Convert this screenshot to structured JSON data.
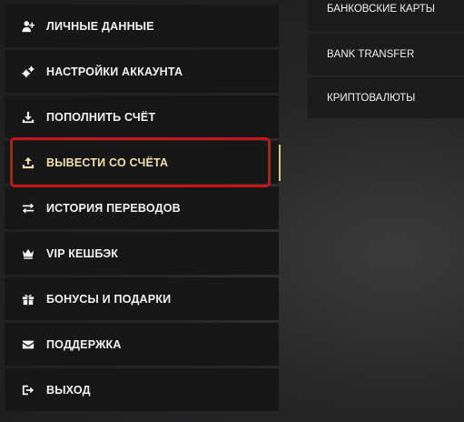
{
  "sidebar": {
    "items": [
      {
        "label": "ЛИЧНЫЕ ДАННЫЕ",
        "icon": "user-plus-icon"
      },
      {
        "label": "НАСТРОЙКИ АККАУНТА",
        "icon": "gears-icon"
      },
      {
        "label": "ПОПОЛНИТЬ СЧЁТ",
        "icon": "download-icon"
      },
      {
        "label": "ВЫВЕСТИ СО СЧЁТА",
        "icon": "upload-icon",
        "active": true
      },
      {
        "label": "ИСТОРИЯ ПЕРЕВОДОВ",
        "icon": "transfer-arrows-icon"
      },
      {
        "label": "VIP КЕШБЭК",
        "icon": "crown-icon"
      },
      {
        "label": "БОНУСЫ И ПОДАРКИ",
        "icon": "gift-icon"
      },
      {
        "label": "ПОДДЕРЖКА",
        "icon": "envelope-icon"
      },
      {
        "label": "ВЫХОД",
        "icon": "logout-icon"
      }
    ]
  },
  "methods": {
    "items": [
      {
        "label": "БАНКОВСКИЕ КАРТЫ"
      },
      {
        "label": "BANK TRANSFER"
      },
      {
        "label": "КРИПТОВАЛЮТЫ"
      }
    ]
  },
  "colors": {
    "item_bg": "#161617",
    "active_text": "#f3dfa8",
    "highlight_border": "#c7141b",
    "text": "#f2f2f2"
  }
}
